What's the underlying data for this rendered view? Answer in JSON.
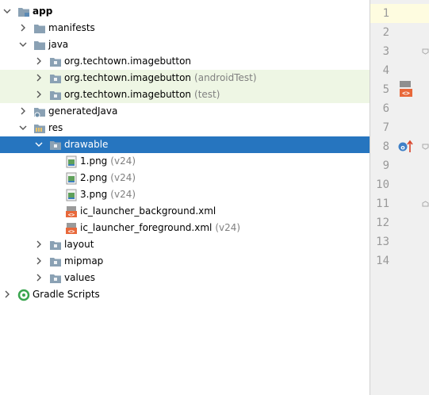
{
  "tree": {
    "nodes": [
      {
        "label": "app",
        "hint": "",
        "bold": true,
        "icon": "module-folder-icon",
        "expanded": true,
        "depth": 0,
        "state": "normal"
      },
      {
        "label": "manifests",
        "hint": "",
        "icon": "folder-icon",
        "expanded": false,
        "depth": 1,
        "state": "normal"
      },
      {
        "label": "java",
        "hint": "",
        "icon": "folder-icon",
        "expanded": true,
        "depth": 1,
        "state": "normal"
      },
      {
        "label": "org.techtown.imagebutton",
        "hint": "",
        "icon": "package-icon",
        "expanded": false,
        "depth": 2,
        "state": "normal"
      },
      {
        "label": "org.techtown.imagebutton",
        "hint": "(androidTest)",
        "icon": "package-icon",
        "expanded": false,
        "depth": 2,
        "state": "alt"
      },
      {
        "label": "org.techtown.imagebutton",
        "hint": "(test)",
        "icon": "package-icon",
        "expanded": false,
        "depth": 2,
        "state": "alt"
      },
      {
        "label": "generatedJava",
        "hint": "",
        "icon": "generated-folder-icon",
        "expanded": false,
        "depth": 1,
        "state": "normal"
      },
      {
        "label": "res",
        "hint": "",
        "icon": "resource-folder-icon",
        "expanded": true,
        "depth": 1,
        "state": "normal"
      },
      {
        "label": "drawable",
        "hint": "",
        "icon": "package-icon",
        "expanded": true,
        "depth": 2,
        "state": "selected"
      },
      {
        "label": "1.png",
        "hint": "(v24)",
        "icon": "image-file-icon",
        "leaf": true,
        "depth": 3,
        "state": "normal"
      },
      {
        "label": "2.png",
        "hint": "(v24)",
        "icon": "image-file-icon",
        "leaf": true,
        "depth": 3,
        "state": "normal"
      },
      {
        "label": "3.png",
        "hint": "(v24)",
        "icon": "image-file-icon",
        "leaf": true,
        "depth": 3,
        "state": "normal"
      },
      {
        "label": "ic_launcher_background.xml",
        "hint": "",
        "icon": "xml-file-icon",
        "leaf": true,
        "depth": 3,
        "state": "normal"
      },
      {
        "label": "ic_launcher_foreground.xml",
        "hint": "(v24)",
        "icon": "xml-file-icon",
        "leaf": true,
        "depth": 3,
        "state": "normal"
      },
      {
        "label": "layout",
        "hint": "",
        "icon": "package-icon",
        "expanded": false,
        "depth": 2,
        "state": "normal"
      },
      {
        "label": "mipmap",
        "hint": "",
        "icon": "package-icon",
        "expanded": false,
        "depth": 2,
        "state": "normal"
      },
      {
        "label": "values",
        "hint": "",
        "icon": "package-icon",
        "expanded": false,
        "depth": 2,
        "state": "normal"
      },
      {
        "label": "Gradle Scripts",
        "hint": "",
        "icon": "gradle-icon",
        "expanded": false,
        "depth": 0,
        "state": "normal"
      }
    ]
  },
  "gutter": {
    "line_numbers": [
      "1",
      "2",
      "3",
      "4",
      "5",
      "6",
      "7",
      "8",
      "9",
      "10",
      "11",
      "12",
      "13",
      "14"
    ],
    "current_line": "1"
  },
  "colors": {
    "selection": "#2675bf",
    "alt_row": "#eef6e4",
    "gutter_bg": "#f0f0f0",
    "current_line": "#fefce0"
  }
}
